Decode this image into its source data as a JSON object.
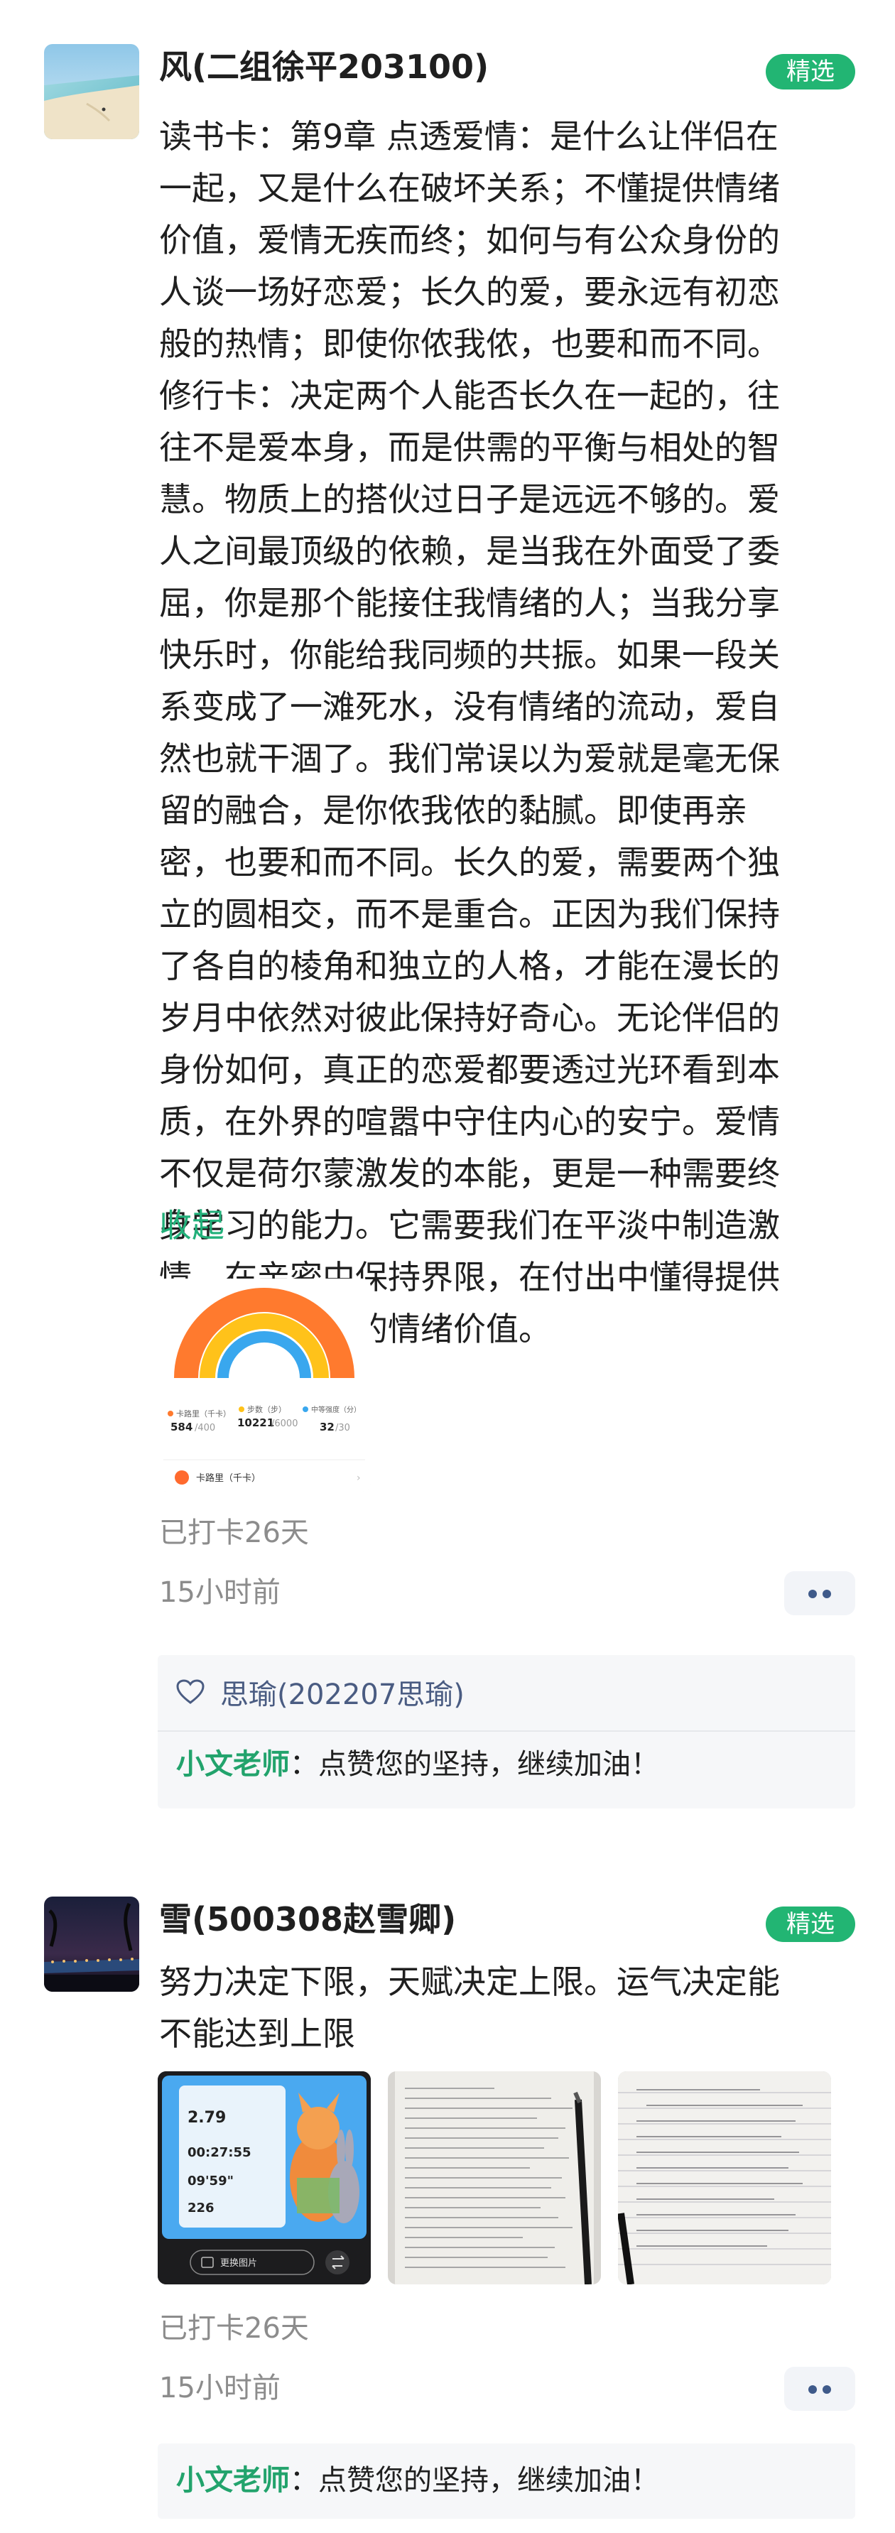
{
  "posts": [
    {
      "author": "风(二组徐平203100)",
      "badge": "精选",
      "lines": [
        "读书卡：第9章 点透爱情：是什么让伴侣在",
        "一起，又是什么在破坏关系；不懂提供情绪",
        "价值，爱情无疾而终；如何与有公众身份的",
        "人谈一场好恋爱；长久的爱，要永远有初恋",
        "般的热情；即使你侬我侬，也要和而不同。",
        "修行卡：决定两个人能否长久在一起的，往",
        "往不是爱本身，而是供需的平衡与相处的智",
        "慧。物质上的搭伙过日子是远远不够的。爱",
        "人之间最顶级的依赖，是当我在外面受了委",
        "屈，你是那个能接住我情绪的人；当我分享",
        "快乐时，你能给我同频的共振。如果一段关",
        "系变成了一滩死水，没有情绪的流动，爱自",
        "然也就干涸了。我们常误以为爱就是毫无保",
        "留的融合，是你侬我侬的黏腻。即使再亲",
        "密，也要和而不同。长久的爱，需要两个独",
        "立的圆相交，而不是重合。正因为我们保持",
        "了各自的棱角和独立的人格，才能在漫长的",
        "岁月中依然对彼此保持好奇心。无论伴侣的",
        "身份如何，真正的恋爱都要透过光环看到本",
        "质，在外界的喧嚣中守住内心的安宁。爱情",
        "不仅是荷尔蒙激发的本能，更是一种需要终",
        "身学习的能力。它需要我们在平淡中制造激",
        "情，在亲密中保持界限，在付出中懂得提供",
        "对方真正需要的情绪价值。"
      ],
      "collapse": "收起",
      "fitness": {
        "stats": [
          {
            "label": "卡路里（千卡）",
            "value": "584",
            "total": "/400"
          },
          {
            "label": "步数（步）",
            "value": "10221",
            "total": "/6000"
          },
          {
            "label": "中等强度（分）",
            "value": "32",
            "total": "/30"
          }
        ],
        "app_name": "卡路里（千卡）"
      },
      "streak": "已打卡26天",
      "time": "15小时前",
      "like_user": "思瑜(202207思瑜)",
      "comment": {
        "who": "小文老师",
        "text": "：点赞您的坚持，继续加油！"
      }
    },
    {
      "author": "雪(500308赵雪卿)",
      "badge": "精选",
      "lines": [
        "努力决定下限，天赋决定上限。运气决定能",
        "不能达到上限"
      ],
      "run_card": {
        "distance": "2.79",
        "duration": "00:27:55",
        "pace": "09'59\"",
        "value": "226",
        "button": "更换图片"
      },
      "streak": "已打卡26天",
      "time": "15小时前",
      "comment": {
        "who": "小文老师",
        "text": "：点赞您的坚持，继续加油！"
      }
    }
  ],
  "colors": {
    "accent": "#22b573",
    "link": "#22b07a",
    "meta": "#8c8c8c",
    "dots": "#3f5a8a"
  }
}
